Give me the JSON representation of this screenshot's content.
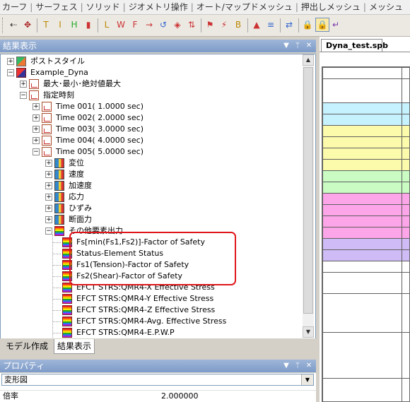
{
  "menubar": {
    "items": [
      "カーフ",
      "サーフェス",
      "ソリッド",
      "ジオメトリ操作",
      "オート/マップドメッシュ",
      "押出しメッシュ",
      "メッシュ"
    ]
  },
  "toolbar": {
    "icons": [
      "arrow-tool-icon",
      "node-tool-icon",
      "t-icon",
      "i-icon",
      "h-icon",
      "bar-chart-icon",
      "l-icon",
      "w-icon",
      "f-icon",
      "arrow-right-icon",
      "rotate-icon",
      "cube-icon",
      "up-down-arrow-icon",
      "flag-icon",
      "lightning-icon",
      "b-icon",
      "mesh-icon",
      "stripes-icon",
      "swap-icon",
      "lock-icon",
      "lock-pressed-icon",
      "exit-icon"
    ],
    "pressed_index": 20
  },
  "results_panel": {
    "title": "結果表示",
    "controls": {
      "dropdown": "▼",
      "pin": "ᛘ",
      "close": "✕"
    },
    "tree": [
      {
        "level": 0,
        "label": "ポストスタイル",
        "icon": "post-style-icon",
        "expander": "+",
        "kind": "post"
      },
      {
        "level": 0,
        "label": "Example_Dyna",
        "icon": "model-icon",
        "expander": "−",
        "kind": "model"
      },
      {
        "level": 1,
        "label": "最大･最小･絶対値最大",
        "icon": "result-doc-icon",
        "expander": "+",
        "kind": "doc"
      },
      {
        "level": 1,
        "label": "指定時刻",
        "icon": "result-doc-icon",
        "expander": "−",
        "kind": "doc"
      },
      {
        "level": 2,
        "label": "Time 001(     1.0000 sec)",
        "icon": "result-doc-icon",
        "expander": "+",
        "kind": "doc"
      },
      {
        "level": 2,
        "label": "Time 002(     2.0000 sec)",
        "icon": "result-doc-icon",
        "expander": "+",
        "kind": "doc"
      },
      {
        "level": 2,
        "label": "Time 003(     3.0000 sec)",
        "icon": "result-doc-icon",
        "expander": "+",
        "kind": "doc"
      },
      {
        "level": 2,
        "label": "Time 004(     4.0000 sec)",
        "icon": "result-doc-icon",
        "expander": "+",
        "kind": "doc"
      },
      {
        "level": 2,
        "label": "Time 005(     5.0000 sec)",
        "icon": "result-doc-icon",
        "expander": "−",
        "kind": "doc"
      },
      {
        "level": 3,
        "label": "変位",
        "icon": "displacement-icon",
        "expander": "+",
        "kind": "spec"
      },
      {
        "level": 3,
        "label": "速度",
        "icon": "velocity-icon",
        "expander": "+",
        "kind": "spec"
      },
      {
        "level": 3,
        "label": "加速度",
        "icon": "acceleration-icon",
        "expander": "+",
        "kind": "spec"
      },
      {
        "level": 3,
        "label": "応力",
        "icon": "stress-icon",
        "expander": "+",
        "kind": "spec"
      },
      {
        "level": 3,
        "label": "ひずみ",
        "icon": "strain-icon",
        "expander": "+",
        "kind": "spec"
      },
      {
        "level": 3,
        "label": "断面力",
        "icon": "section-force-icon",
        "expander": "+",
        "kind": "spec"
      },
      {
        "level": 3,
        "label": "その他要素出力",
        "icon": "other-output-icon",
        "expander": "−",
        "kind": "multi"
      },
      {
        "level": 4,
        "label": "Fs[min(Fs1,Fs2)]-Factor of Safety",
        "icon": "contour-result-icon",
        "kind": "multi"
      },
      {
        "level": 4,
        "label": "Status-Element Status",
        "icon": "contour-result-icon",
        "kind": "multi"
      },
      {
        "level": 4,
        "label": "Fs1(Tension)-Factor of Safety",
        "icon": "contour-result-icon",
        "kind": "multi"
      },
      {
        "level": 4,
        "label": "Fs2(Shear)-Factor of Safety",
        "icon": "contour-result-icon",
        "kind": "multi"
      },
      {
        "level": 4,
        "label": "EFCT STRS:QMR4-X Effective Stress",
        "icon": "contour-result-icon",
        "kind": "multi"
      },
      {
        "level": 4,
        "label": "EFCT STRS:QMR4-Y Effective Stress",
        "icon": "contour-result-icon",
        "kind": "multi"
      },
      {
        "level": 4,
        "label": "EFCT STRS:QMR4-Z Effective Stress",
        "icon": "contour-result-icon",
        "kind": "multi"
      },
      {
        "level": 4,
        "label": "EFCT STRS:QMR4-Avg. Effective Stress",
        "icon": "contour-result-icon",
        "kind": "multi"
      },
      {
        "level": 4,
        "label": "EFCT STRS:QMR4-E.P.W.P",
        "icon": "contour-result-icon",
        "kind": "multi"
      }
    ]
  },
  "bottom_tabs": {
    "model": "モデル作成",
    "results": "結果表示"
  },
  "properties_panel": {
    "title": "プロパティ",
    "combo_value": "変形図",
    "row_label": "倍率",
    "row_value": "2.000000"
  },
  "document": {
    "tab_label": "Dyna_test.spb",
    "band_colors": [
      "#c6f1ff",
      "#fbfbab",
      "#fbfbab",
      "#c9fbc3",
      "#fca5e8",
      "#fca5e8",
      "#cfbcf6"
    ]
  },
  "colors": {
    "highlight": "#e0161b",
    "panel_title": "#7d9bc8"
  }
}
